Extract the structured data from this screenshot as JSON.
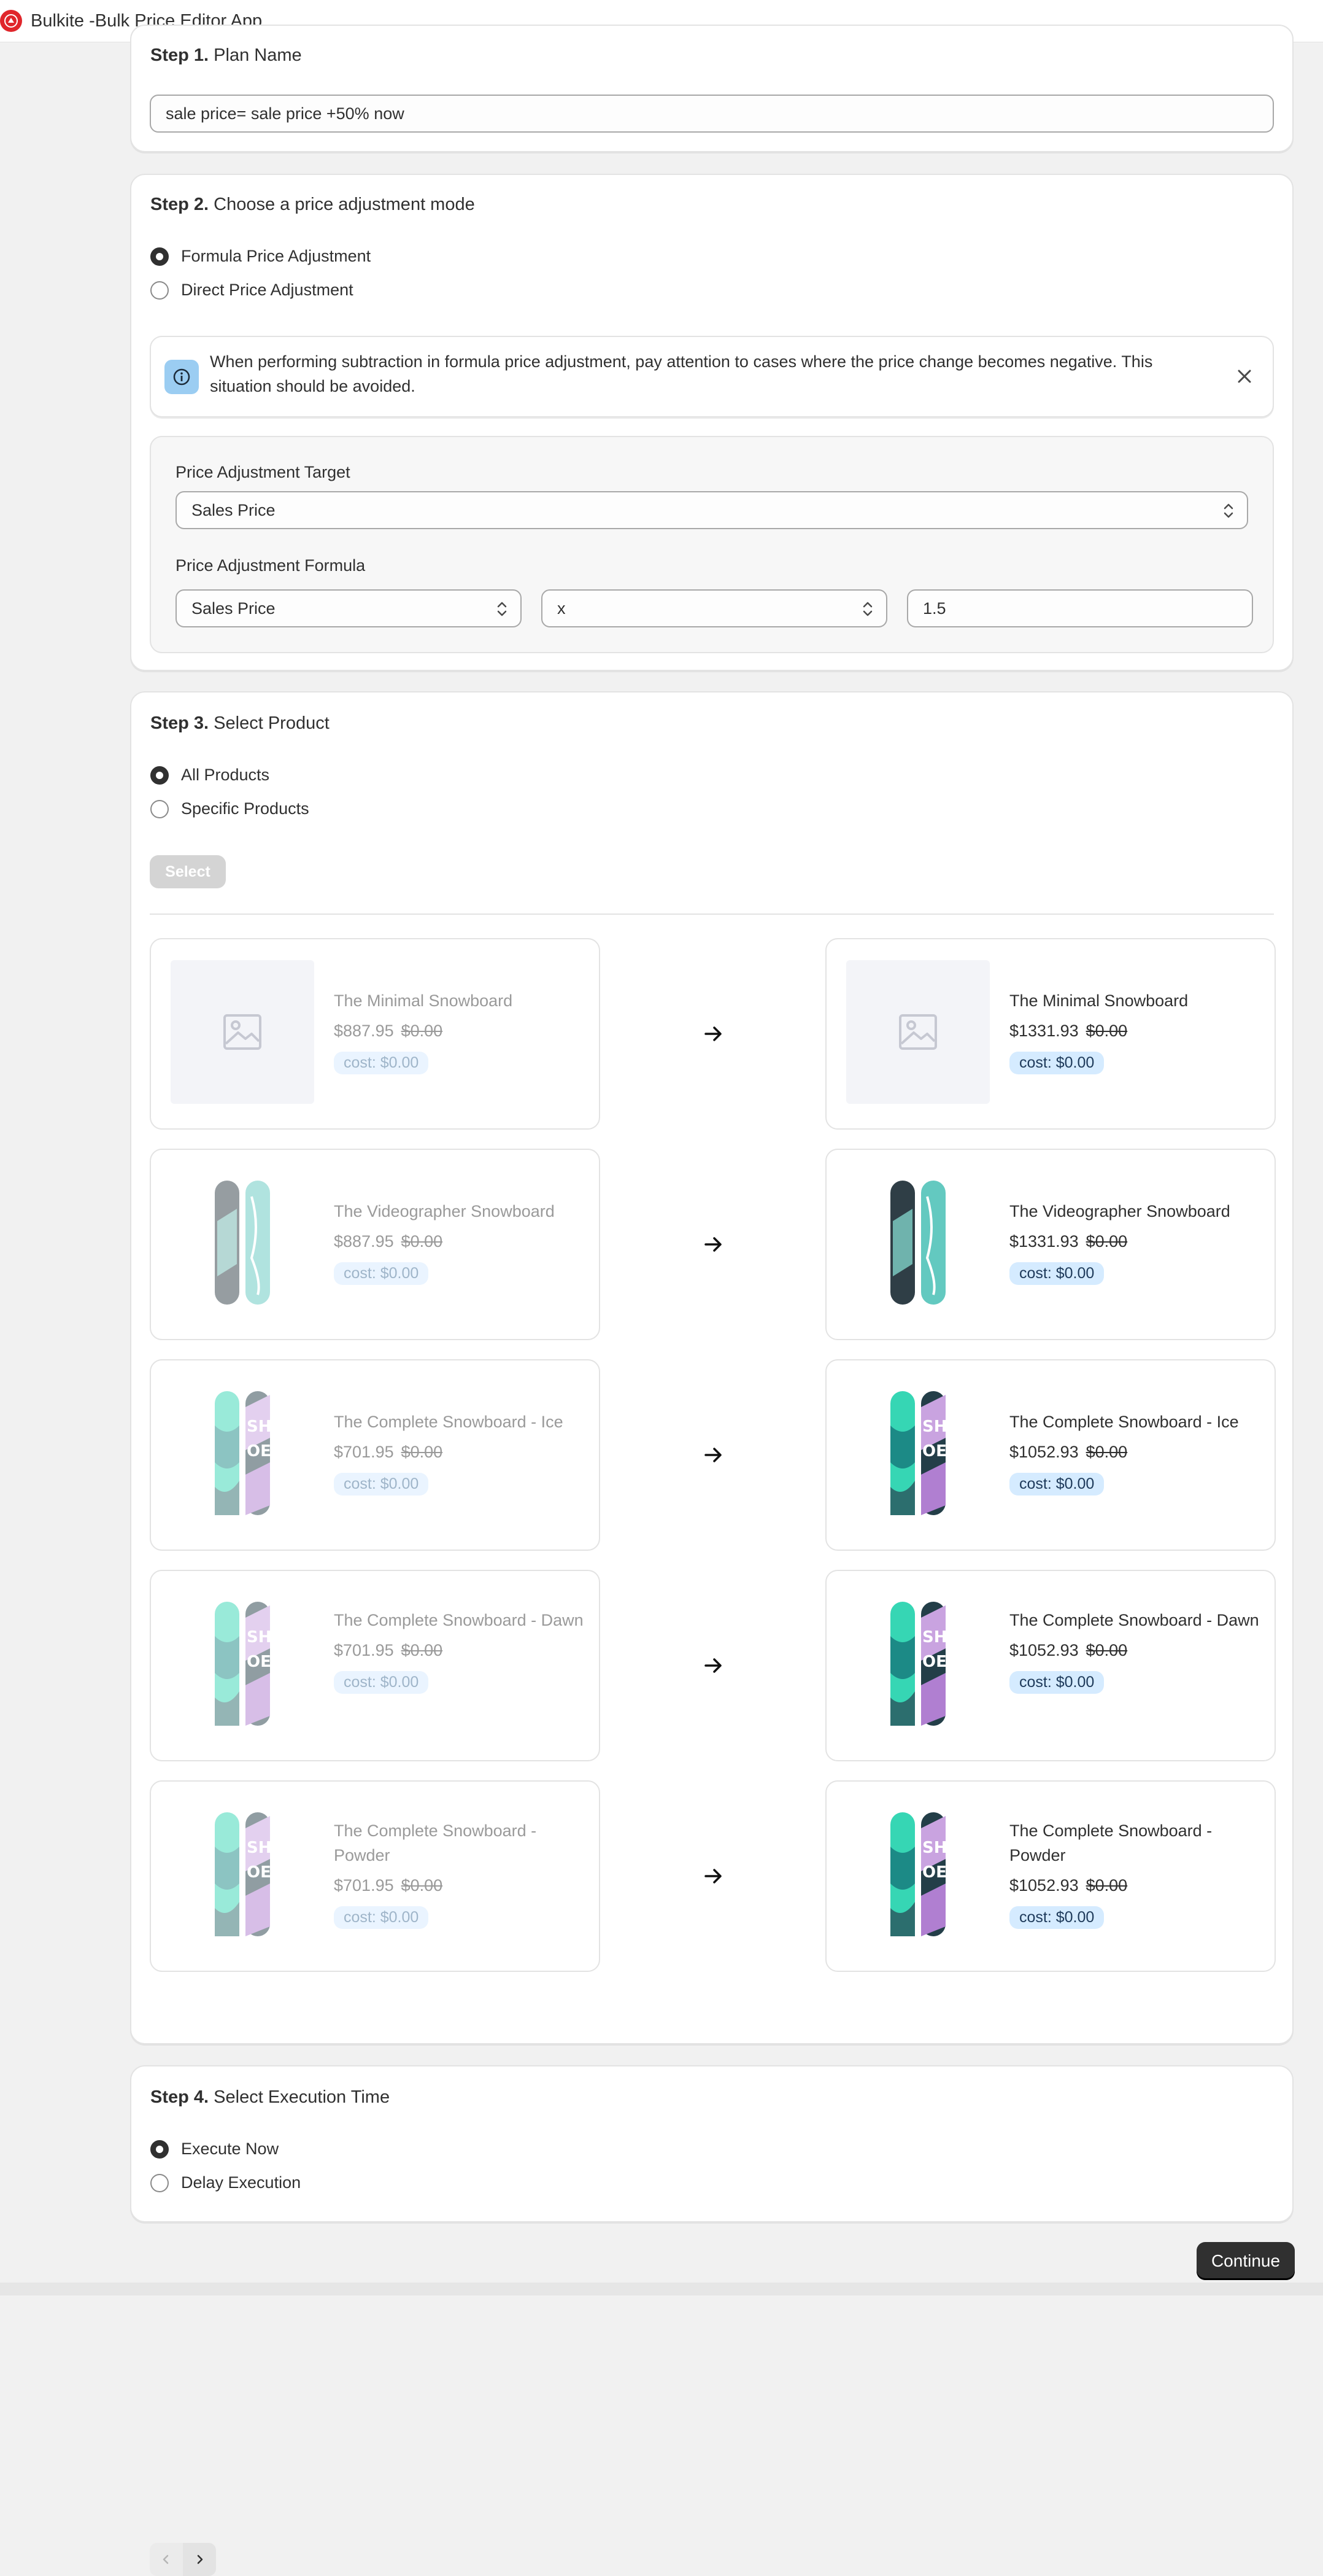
{
  "app": {
    "title": "Bulkite -Bulk Price Editor App",
    "logo": "app-logo"
  },
  "step1": {
    "num": "Step 1.",
    "title": "Plan Name",
    "value": "sale price= sale price +50%  now"
  },
  "step2": {
    "num": "Step 2.",
    "title": "Choose a price adjustment mode",
    "options": [
      "Formula Price Adjustment",
      "Direct Price Adjustment"
    ],
    "selected": "Formula Price Adjustment",
    "banner": "When performing subtraction in formula price adjustment, pay attention to cases where the price change becomes negative. This situation should be avoided.",
    "target_label": "Price Adjustment Target",
    "target_value": "Sales Price",
    "formula_label": "Price Adjustment Formula",
    "formula_field": "Sales Price",
    "formula_operator": "x",
    "formula_value": "1.5"
  },
  "step3": {
    "num": "Step 3.",
    "title": "Select Product",
    "options": [
      "All Products",
      "Specific Products"
    ],
    "selected": "All Products",
    "select_button": "Select",
    "products": [
      {
        "name": "The Minimal Snowboard",
        "old_price": "$887.95",
        "new_price": "$1331.93",
        "compare": "$0.00",
        "cost": "cost: $0.00",
        "image": "placeholder-image-icon"
      },
      {
        "name": "The Videographer Snowboard",
        "old_price": "$887.95",
        "new_price": "$1331.93",
        "compare": "$0.00",
        "cost": "cost: $0.00",
        "image": "snowboard-videographer"
      },
      {
        "name": "The Complete Snowboard - Ice",
        "old_price": "$701.95",
        "new_price": "$1052.93",
        "compare": "$0.00",
        "cost": "cost: $0.00",
        "image": "snowboard-complete"
      },
      {
        "name": "The Complete Snowboard - Dawn",
        "old_price": "$701.95",
        "new_price": "$1052.93",
        "compare": "$0.00",
        "cost": "cost: $0.00",
        "image": "snowboard-complete"
      },
      {
        "name": "The Complete Snowboard - Powder",
        "old_price": "$701.95",
        "new_price": "$1052.93",
        "compare": "$0.00",
        "cost": "cost: $0.00",
        "image": "snowboard-complete"
      }
    ]
  },
  "step4": {
    "num": "Step 4.",
    "title": "Select Execution Time",
    "options": [
      "Execute Now",
      "Delay Execution"
    ],
    "selected": "Execute Now"
  },
  "continue_label": "Continue",
  "colors": {
    "primary": "#303030",
    "brand_red": "#e0262b",
    "cost_badge": "#d5ebff",
    "info_icon_bg": "#9bcdf2"
  }
}
